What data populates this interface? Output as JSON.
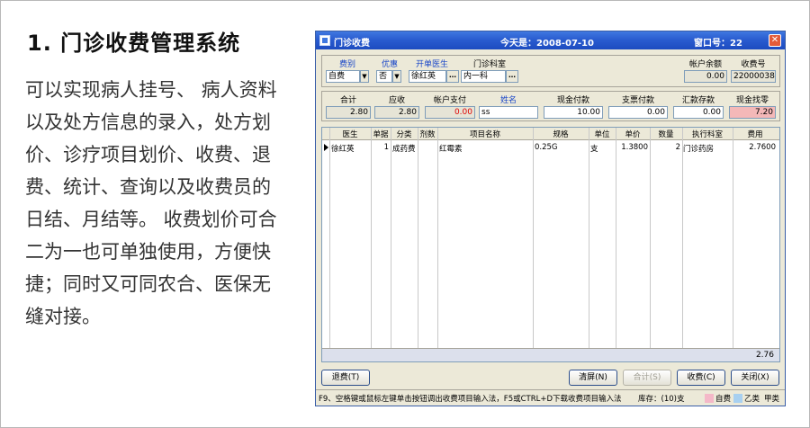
{
  "slide": {
    "title": "1. 门诊收费管理系统",
    "body_lines": [
      "可以实现病人挂号、 病人资料",
      "以及处方信息的录入，处方划",
      "价、诊疗项目划价、收费、退",
      "费、统计、查询以及收费员的",
      "日结、月结等。 收费划价可合",
      "二为一也可单独使用，方便快",
      "捷；同时又可同农合、医保无",
      "缝对接。"
    ]
  },
  "window": {
    "title": "门诊收费",
    "today": "今天是：2008-07-10",
    "window_no": "窗口号：22",
    "close_glyph": "✕"
  },
  "form_top": {
    "labels": {
      "fee_type": "费别",
      "discount": "优惠",
      "doctor": "开单医生",
      "dept": "门诊科室",
      "balance": "帐户余额",
      "receipt": "收费号"
    },
    "values": {
      "fee_type": "自费",
      "discount": "否",
      "doctor": "徐红英",
      "dept": "内一科",
      "balance": "0.00",
      "receipt": "22000038"
    }
  },
  "form_money": {
    "labels": {
      "total": "合计",
      "receivable": "应收",
      "account_pay": "帐户支付",
      "name": "姓名",
      "cash": "现金付款",
      "check": "支票付款",
      "remit": "汇款存款",
      "change": "现金找零"
    },
    "values": {
      "total": "2.80",
      "receivable": "2.80",
      "account_pay": "0.00",
      "name": "ss",
      "cash": "10.00",
      "check": "0.00",
      "remit": "0.00",
      "change": "7.20"
    }
  },
  "table": {
    "columns": [
      "医生",
      "单据",
      "分类",
      "剂数",
      "项目名称",
      "规格",
      "单位",
      "单价",
      "数量",
      "执行科室",
      "费用"
    ],
    "rows": [
      {
        "doctor": "徐红英",
        "slip": "1",
        "category": "成药费",
        "doses": "",
        "item": "红霉素",
        "spec": "0.25G",
        "unit": "支",
        "price": "1.3800",
        "qty": "2",
        "exec_dept": "门诊药房",
        "fee": "2.7600"
      }
    ],
    "total": "2.76"
  },
  "buttons": {
    "refund": "退费(T)",
    "clear": "清屏(N)",
    "sum": "合计(S)",
    "charge": "收费(C)",
    "close": "关闭(X)"
  },
  "status": {
    "hint": "F9、空格键或鼠标左键单击按钮调出收费项目输入法，F5或CTRL+D下载收费项目输入法",
    "stock": "库存：(10)支",
    "legend": [
      {
        "label": "自费",
        "color": "#f4b8c8"
      },
      {
        "label": "乙类",
        "color": "#a8d0f0"
      },
      {
        "label": "甲类",
        "color": "#ece9d8"
      }
    ]
  }
}
